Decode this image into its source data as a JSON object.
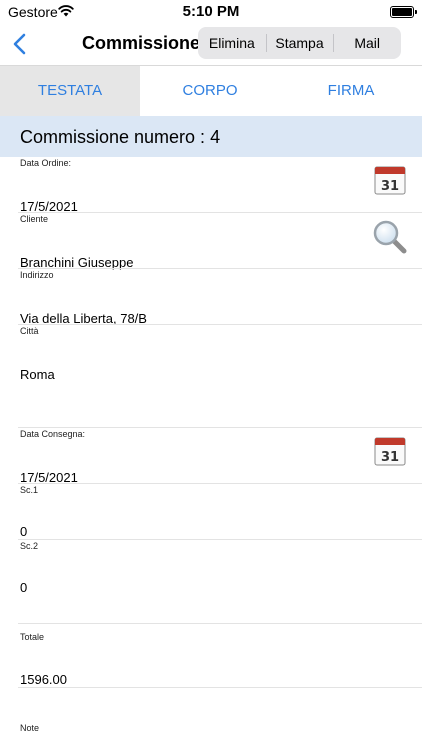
{
  "status": {
    "carrier": "Gestore",
    "time": "5:10 PM",
    "battery_level": 1.0
  },
  "nav": {
    "title": "Commissione",
    "actions": {
      "delete": "Elimina",
      "print": "Stampa",
      "mail": "Mail"
    }
  },
  "tabs": {
    "header": "TESTATA",
    "body": "CORPO",
    "signature": "FIRMA",
    "active": "header"
  },
  "section": {
    "title": "Commissione numero : 4"
  },
  "fields": {
    "data_ordine": {
      "label": "Data Ordine:",
      "value": "17/5/2021"
    },
    "cliente": {
      "label": "Cliente",
      "value": "Branchini Giuseppe"
    },
    "indirizzo": {
      "label": "Indirizzo",
      "value": "Via della Liberta, 78/B"
    },
    "citta": {
      "label": "Città",
      "value": "Roma"
    },
    "data_consegna": {
      "label": "Data Consegna:",
      "value": "17/5/2021"
    },
    "sc1": {
      "label": "Sc.1",
      "value": "0"
    },
    "sc2": {
      "label": "Sc.2",
      "value": "0"
    },
    "totale": {
      "label": "Totale",
      "value": "1596.00"
    },
    "note": {
      "label": "Note",
      "value": ""
    }
  },
  "icons": {
    "back": "chevron-left-icon",
    "calendar": "calendar-icon",
    "calendar_day": "31",
    "search": "magnifier-icon"
  },
  "colors": {
    "accent": "#2f7fe0",
    "section_bg": "#dbe7f5",
    "active_tab_bg": "#e6e6e6",
    "calendar_red": "#c0392b"
  }
}
